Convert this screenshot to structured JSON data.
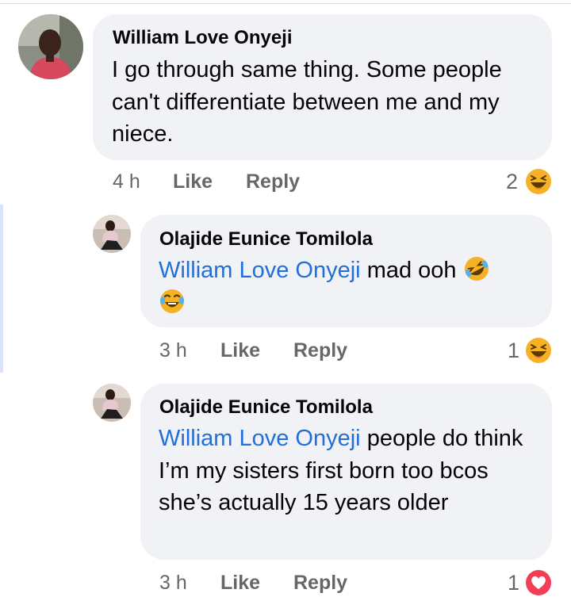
{
  "comments": [
    {
      "author": "William Love Onyeji",
      "text": "I go through same thing. Some people can't differentiate between me and my niece.",
      "time": "4 h",
      "like_label": "Like",
      "reply_label": "Reply",
      "reaction_count": "2",
      "reaction_icon": "haha-emoji-icon"
    }
  ],
  "replies": [
    {
      "author": "Olajide Eunice Tomilola",
      "mention": "William Love Onyeji",
      "text": " mad ooh ",
      "time": "3 h",
      "like_label": "Like",
      "reply_label": "Reply",
      "reaction_count": "1",
      "reaction_icon": "haha-emoji-icon"
    },
    {
      "author": "Olajide Eunice Tomilola",
      "mention": "William Love Onyeji",
      "text": " people do think I’m my sisters first born too bcos she’s actually 15 years older",
      "time": "3 h",
      "like_label": "Like",
      "reply_label": "Reply",
      "reaction_count": "1",
      "reaction_icon": "love-heart-icon"
    }
  ],
  "colors": {
    "bubble": "#f0f2f5",
    "mention": "#216fdb",
    "meta": "#65676b",
    "haha": "#f7b125",
    "love": "#f33e58"
  }
}
